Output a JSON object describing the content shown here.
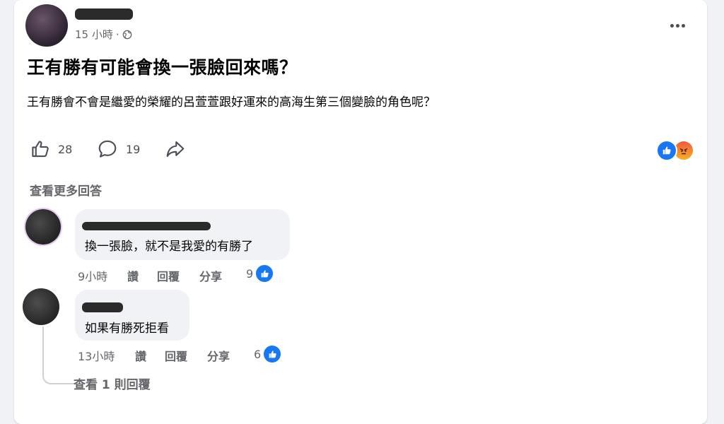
{
  "post": {
    "time": "15 小時",
    "separator": "·",
    "title": "王有勝有可能會換一張臉回來嗎？",
    "body": "王有勝會不會是繼愛的榮耀的呂萱萱跟好運來的高海生第三個變臉的角色呢？",
    "like_count": "28",
    "comment_count": "19",
    "icons": {
      "like": "thumbs-up-icon",
      "comment": "comment-bubble-icon",
      "share": "share-arrow-icon",
      "privacy": "globe-icon",
      "more": "more-dots-icon"
    }
  },
  "view_more_comments": "查看更多回答",
  "comments": [
    {
      "text": "換一張臉，就不是我愛的有勝了",
      "time": "9小時",
      "like_label": "讚",
      "reply_label": "回覆",
      "share_label": "分享",
      "likes": "9"
    },
    {
      "text": "如果有勝死拒看",
      "time": "13小時",
      "like_label": "讚",
      "reply_label": "回覆",
      "share_label": "分享",
      "likes": "6"
    }
  ],
  "view_replies": "查看 1 則回覆",
  "colors": {
    "accent": "#1877f2",
    "background": "#f0f2f5",
    "secondary_text": "#65676b"
  }
}
